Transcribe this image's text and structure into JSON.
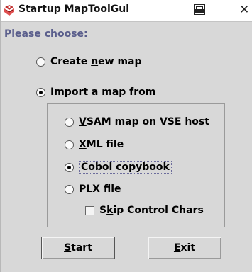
{
  "window": {
    "title": "Startup MapToolGui"
  },
  "prompt": "Please choose:",
  "options": {
    "create_new": {
      "pre": "Create ",
      "mn": "n",
      "post": "ew map",
      "checked": false
    },
    "import_from": {
      "pre": "",
      "mn": "I",
      "post": "mport a map from",
      "checked": true
    }
  },
  "sources": [
    {
      "pre": "",
      "mn": "V",
      "post": "SAM map on VSE host",
      "checked": false
    },
    {
      "pre": "",
      "mn": "X",
      "post": "ML file",
      "checked": false
    },
    {
      "pre": "",
      "mn": "C",
      "post": "obol copybook",
      "checked": true
    },
    {
      "pre": "",
      "mn": "P",
      "post": "LX file",
      "checked": false
    }
  ],
  "skip_control_chars": {
    "pre": "S",
    "mn": "k",
    "post": "ip Control Chars",
    "checked": false
  },
  "buttons": {
    "start": {
      "mn": "S",
      "post": "tart"
    },
    "exit": {
      "pre": "",
      "mn": "E",
      "post": "xit"
    }
  },
  "colors": {
    "prompt": "#5a5e8c",
    "background": "#d8d8d8"
  }
}
